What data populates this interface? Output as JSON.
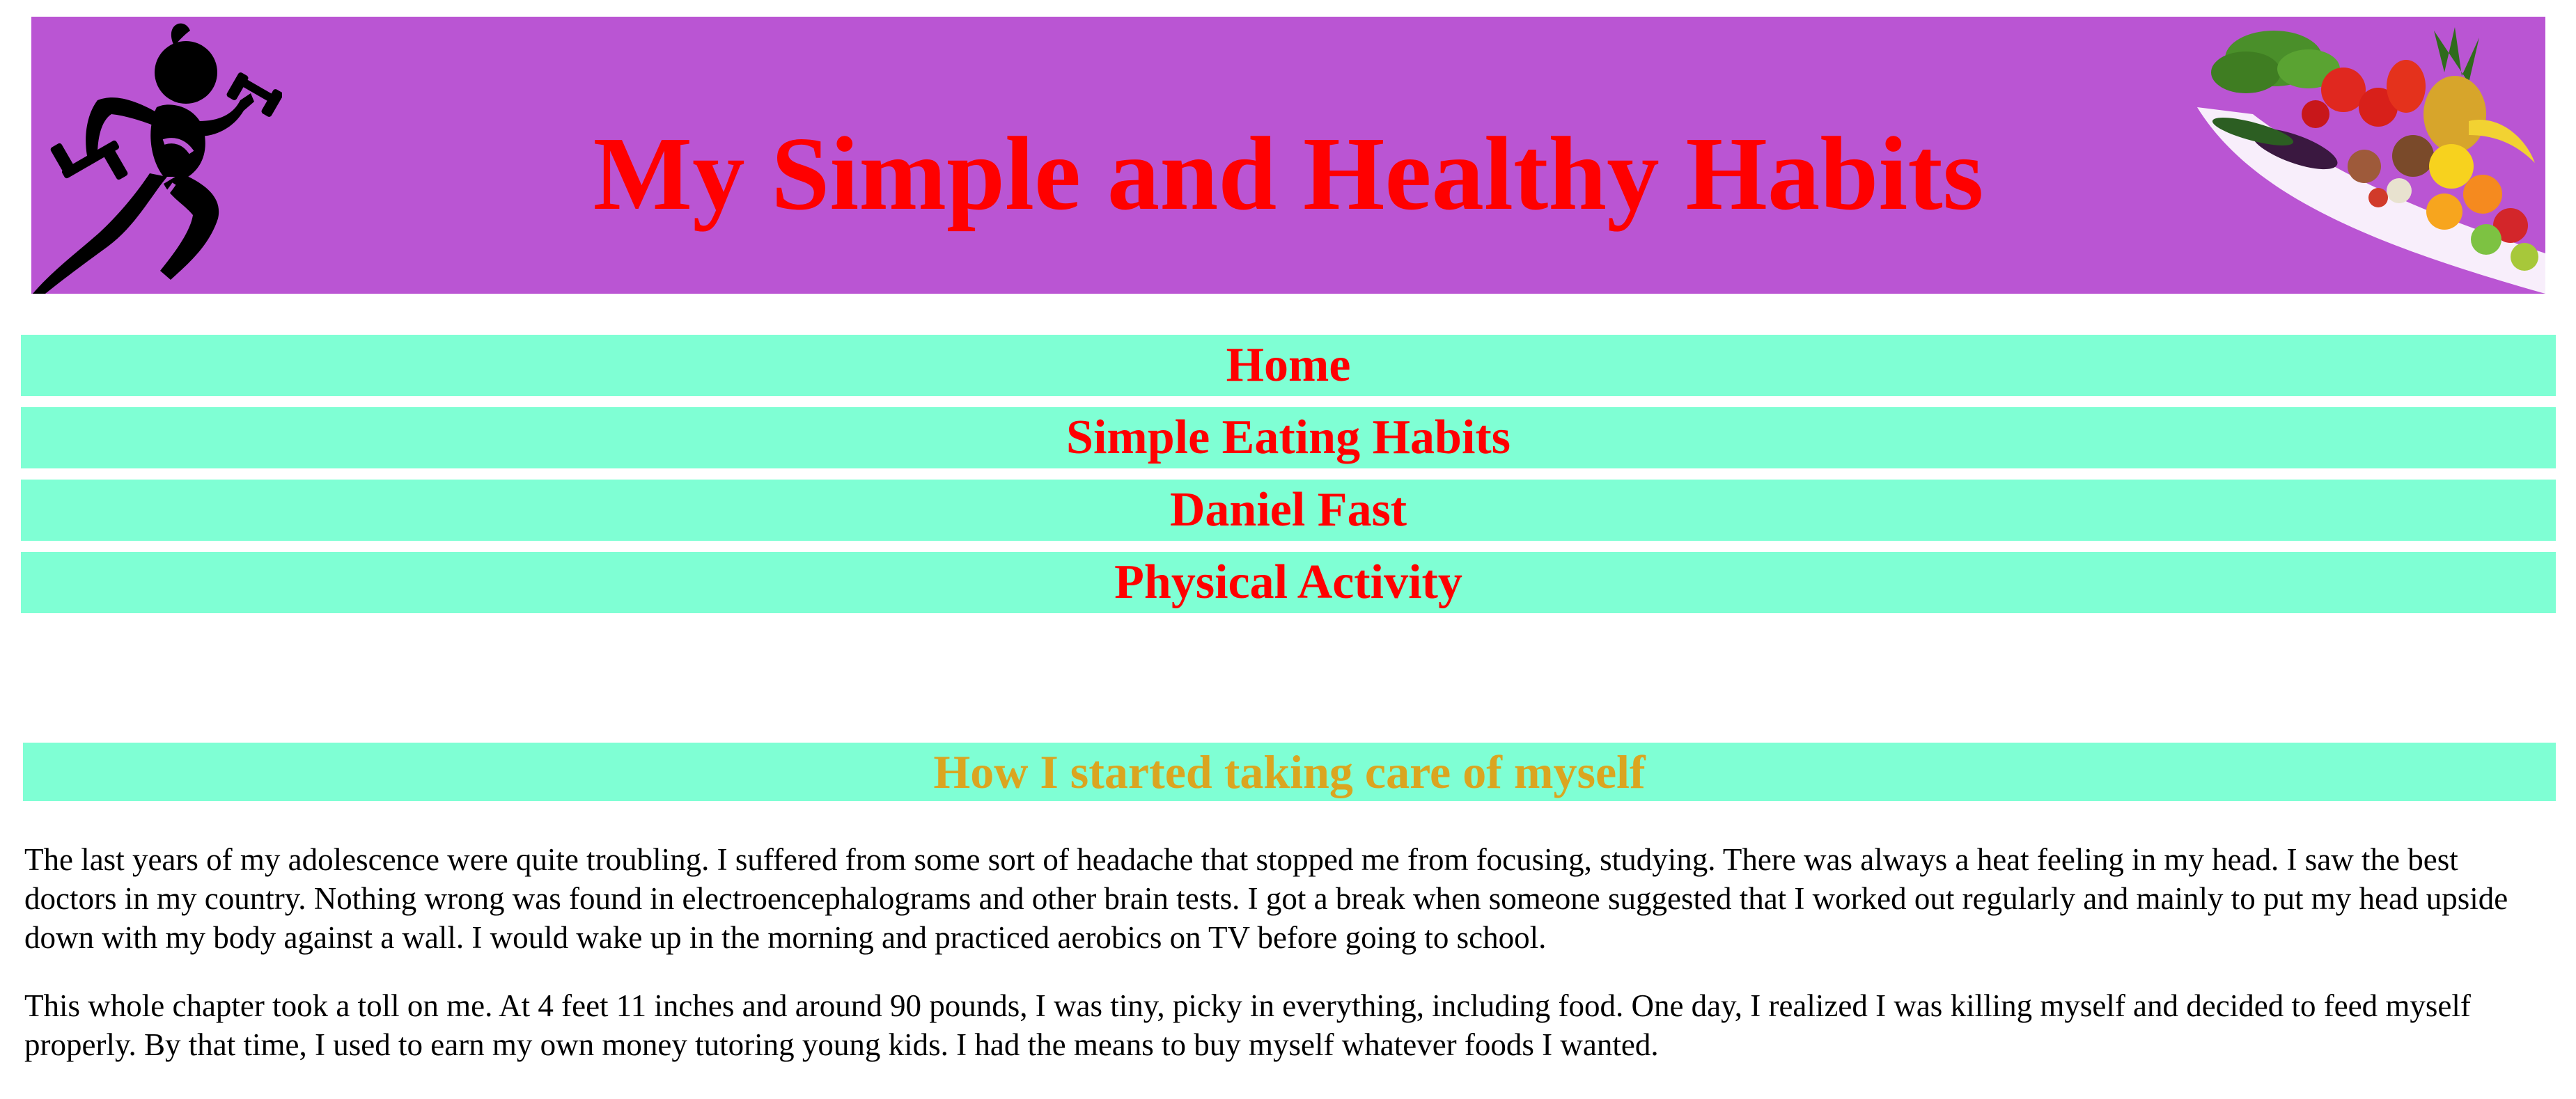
{
  "header": {
    "title": "My Simple and Healthy Habits",
    "background_color": "#ba55d3",
    "title_color": "#ff0000",
    "left_image": "runner-with-dumbbells-icon",
    "right_image": "fruits-and-vegetables-cornucopia"
  },
  "nav": {
    "background_color": "#7fffd4",
    "text_color": "#ff0000",
    "items": [
      {
        "label": "Home"
      },
      {
        "label": "Simple Eating Habits"
      },
      {
        "label": "Daniel Fast"
      },
      {
        "label": "Physical Activity"
      }
    ]
  },
  "main": {
    "heading": "How I started taking care of myself",
    "heading_color": "#daa520",
    "paragraphs": [
      "The last years of my adolescence were quite troubling. I suffered from some sort of headache that stopped me from focusing, studying. There was always a heat feeling in my head. I saw the best doctors in my country. Nothing wrong was found in electroencephalograms and other brain tests. I got a break when someone suggested that I worked out regularly and mainly to put my head upside down with my body against a wall. I would wake up in the morning and practiced aerobics on TV before going to school.",
      "This whole chapter took a toll on me. At 4 feet 11 inches and around 90 pounds, I was tiny, picky in everything, including food. One day, I realized I was killing myself and decided to feed myself properly. By that time, I used to earn my own money tutoring young kids. I had the means to buy myself whatever foods I wanted."
    ]
  }
}
